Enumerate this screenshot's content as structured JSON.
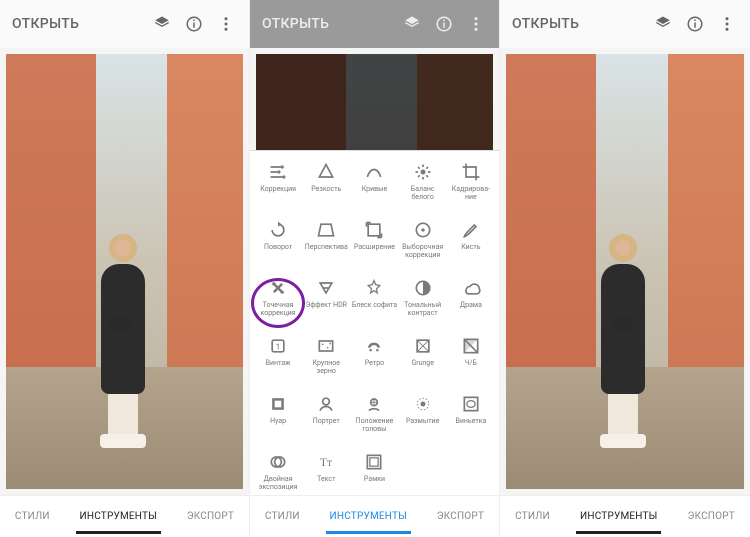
{
  "header": {
    "open_label": "ОТКРЫТЬ"
  },
  "tabs": {
    "styles": "СТИЛИ",
    "tools": "ИНСТРУМЕНТЫ",
    "export": "ЭКСПОРТ"
  },
  "highlight_tool_index": 10,
  "tools": [
    {
      "name": "tune-icon",
      "label": "Коррекция"
    },
    {
      "name": "details-icon",
      "label": "Резкость"
    },
    {
      "name": "curves-icon",
      "label": "Кривые"
    },
    {
      "name": "white-balance-icon",
      "label": "Баланс белого"
    },
    {
      "name": "crop-icon",
      "label": "Кадрирова-ние"
    },
    {
      "name": "rotate-icon",
      "label": "Поворот"
    },
    {
      "name": "perspective-icon",
      "label": "Перспектива"
    },
    {
      "name": "expand-icon",
      "label": "Расширение"
    },
    {
      "name": "selective-icon",
      "label": "Выборочная коррекция"
    },
    {
      "name": "brush-icon",
      "label": "Кисть"
    },
    {
      "name": "healing-icon",
      "label": "Точечная коррекция"
    },
    {
      "name": "hdr-icon",
      "label": "Эффект HDR"
    },
    {
      "name": "glamour-icon",
      "label": "Блеск софита"
    },
    {
      "name": "tonal-contrast-icon",
      "label": "Тональный контраст"
    },
    {
      "name": "drama-icon",
      "label": "Драма"
    },
    {
      "name": "vintage-icon",
      "label": "Винтаж"
    },
    {
      "name": "grainy-film-icon",
      "label": "Крупное зерно"
    },
    {
      "name": "retrolux-icon",
      "label": "Ретро"
    },
    {
      "name": "grunge-icon",
      "label": "Grunge"
    },
    {
      "name": "bw-icon",
      "label": "Ч/Б"
    },
    {
      "name": "noir-icon",
      "label": "Нуар"
    },
    {
      "name": "portrait-icon",
      "label": "Портрет"
    },
    {
      "name": "head-pose-icon",
      "label": "Положение головы"
    },
    {
      "name": "lens-blur-icon",
      "label": "Размытие"
    },
    {
      "name": "vignette-icon",
      "label": "Виньетка"
    },
    {
      "name": "double-exposure-icon",
      "label": "Двойная экспозиция"
    },
    {
      "name": "text-icon",
      "label": "Текст"
    },
    {
      "name": "frames-icon",
      "label": "Рамки"
    }
  ]
}
